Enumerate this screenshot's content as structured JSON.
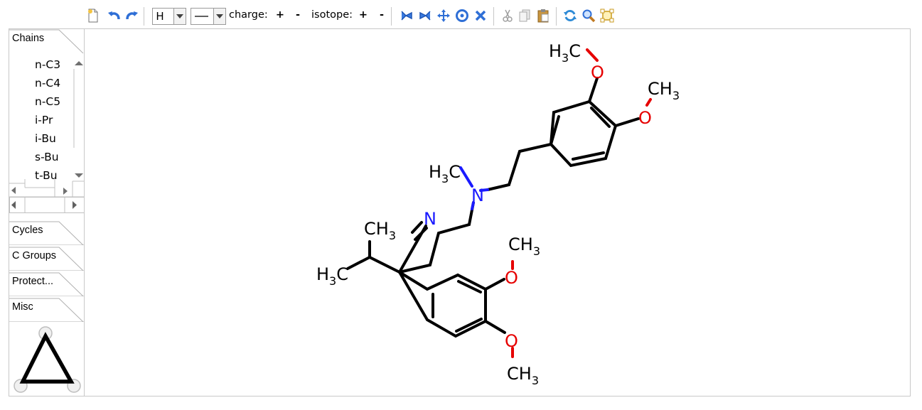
{
  "toolbar": {
    "element_value": "H",
    "charge_label": "charge:",
    "isotope_label": "isotope:",
    "plus": "+",
    "minus": "-",
    "icons": [
      "new-document-icon",
      "undo-icon",
      "redo-icon",
      "element-dropdown",
      "bond-dropdown",
      "rotate-left-icon",
      "rotate-right-icon",
      "move-icon",
      "center-icon",
      "delete-icon",
      "cut-icon",
      "copy-icon",
      "paste-icon",
      "refresh-icon",
      "zoom-icon",
      "select-all-icon"
    ]
  },
  "panel": {
    "tabs": {
      "chains": "Chains",
      "cycles": "Cycles",
      "c_groups": "C Groups",
      "protect": "Protect...",
      "misc": "Misc"
    },
    "chain_items": [
      "n-C3",
      "n-C4",
      "n-C5",
      "i-Pr",
      "i-Bu",
      "s-Bu",
      "t-Bu"
    ]
  },
  "molecule": {
    "labels": {
      "ch3_top_left": "H3C",
      "o_top": "O",
      "ch3_top_right": "CH3",
      "o_top_right": "O",
      "n_amine_methyl": "H3C",
      "n_amine": "N",
      "n_nitrile": "N",
      "ipr_ch3_top": "CH3",
      "ipr_ch3_left": "H3C",
      "o_mid": "O",
      "ch3_mid": "CH3",
      "o_bottom": "O",
      "ch3_bottom": "CH3"
    },
    "colors": {
      "bond": "#000000",
      "oxygen": "#e60000",
      "nitrogen": "#1a1aff"
    }
  }
}
